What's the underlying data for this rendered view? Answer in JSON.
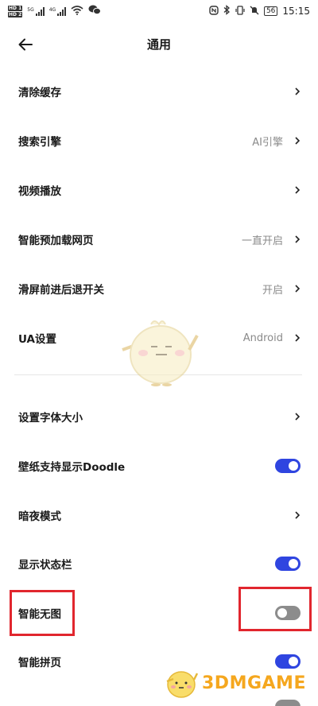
{
  "status_bar": {
    "hd1": "HD 1",
    "hd2": "HD 2",
    "net1": "5G",
    "net2": "4G",
    "battery": "56",
    "time": "15:15"
  },
  "header": {
    "title": "通用"
  },
  "settings": [
    {
      "label": "清除缓存",
      "value": "",
      "control": "chevron"
    },
    {
      "label": "搜索引擎",
      "value": "AI引擎",
      "control": "chevron"
    },
    {
      "label": "视频播放",
      "value": "",
      "control": "chevron"
    },
    {
      "label": "智能预加载网页",
      "value": "一直开启",
      "control": "chevron"
    },
    {
      "label": "滑屏前进后退开关",
      "value": "开启",
      "control": "chevron"
    },
    {
      "label": "UA设置",
      "value": "Android",
      "control": "chevron"
    },
    {
      "label": "设置字体大小",
      "value": "",
      "control": "chevron"
    },
    {
      "label": "壁纸支持显示Doodle",
      "control": "toggle",
      "on": true
    },
    {
      "label": "暗夜模式",
      "value": "",
      "control": "chevron"
    },
    {
      "label": "显示状态栏",
      "control": "toggle",
      "on": true
    },
    {
      "label": "智能无图",
      "control": "toggle",
      "on": false
    },
    {
      "label": "智能拼页",
      "control": "toggle",
      "on": true
    }
  ],
  "watermark": {
    "text": "3DMGAME",
    "icon": "chick-mascot-icon"
  },
  "colors": {
    "toggle_on": "#2f45e0",
    "toggle_off": "#8c8c8c",
    "highlight": "#e1262e",
    "watermark": "#f5a71e"
  }
}
